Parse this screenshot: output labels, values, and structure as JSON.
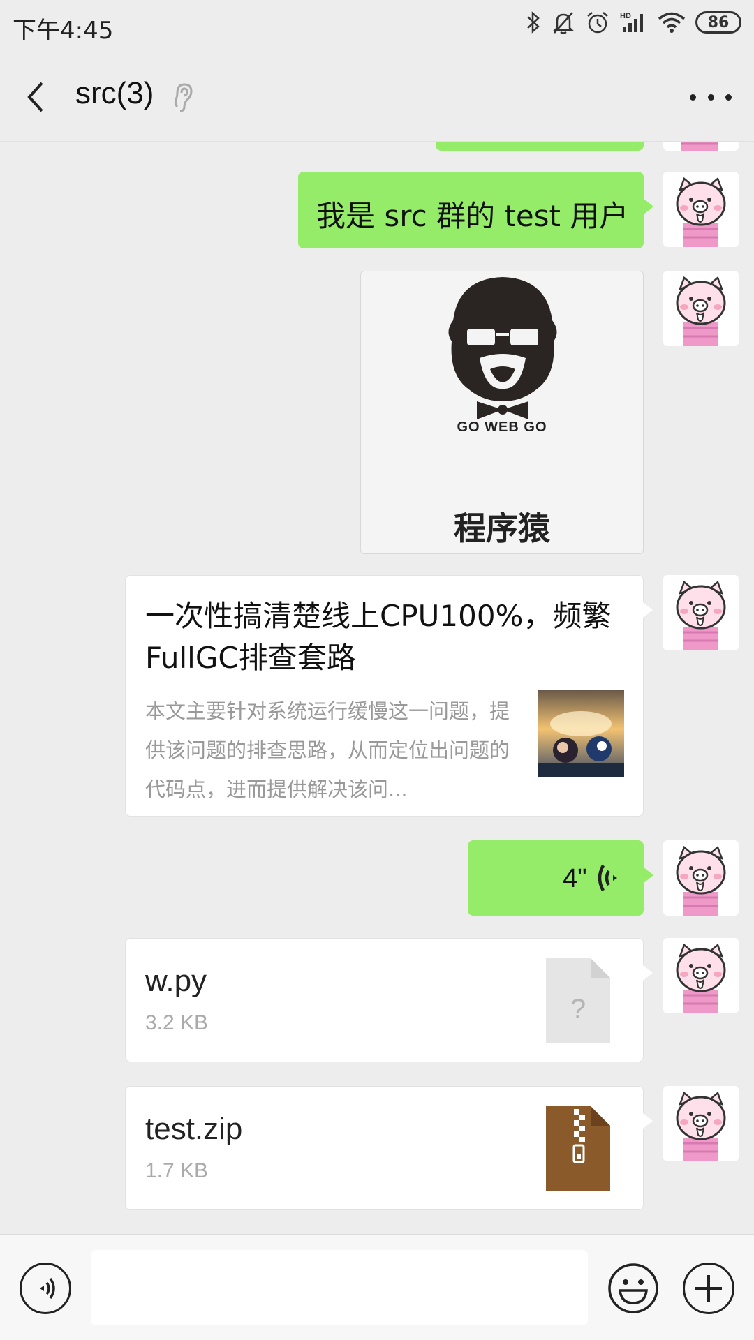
{
  "status_bar": {
    "time": "下午4:45",
    "battery": "86",
    "icons": [
      "bluetooth-icon",
      "mute-bell-icon",
      "alarm-icon",
      "hd-signal-icon",
      "wifi-icon",
      "battery-icon"
    ]
  },
  "header": {
    "title": "src(3)",
    "icons": [
      "back-icon",
      "ear-icon",
      "more-icon"
    ]
  },
  "messages": [
    {
      "type": "text",
      "sender": "self",
      "text": "我是 src 群的 test 用户"
    },
    {
      "type": "sticker",
      "sender": "self",
      "brand": "GO WEB GO",
      "caption": "程序猿"
    },
    {
      "type": "article",
      "sender": "self",
      "title": "一次性搞清楚线上CPU100%，频繁FullGC排查套路",
      "description": "本文主要针对系统运行缓慢这一问题，提供该问题的排查思路，从而定位出问题的代码点，进而提供解决该问..."
    },
    {
      "type": "voice",
      "sender": "self",
      "duration": "4\""
    },
    {
      "type": "file",
      "sender": "self",
      "name": "w.py",
      "size": "3.2 KB",
      "icon": "unknown-file-icon"
    },
    {
      "type": "file",
      "sender": "self",
      "name": "test.zip",
      "size": "1.7 KB",
      "icon": "zip-file-icon"
    }
  ],
  "input_bar": {
    "placeholder": "",
    "icons": [
      "voice-mode-icon",
      "emoji-icon",
      "plus-icon"
    ]
  },
  "colors": {
    "background": "#ededed",
    "self_bubble": "#95ec69",
    "card_bubble": "#ffffff",
    "zip_icon": "#8b5a2b",
    "unknown_file_icon": "#e5e5e5"
  }
}
